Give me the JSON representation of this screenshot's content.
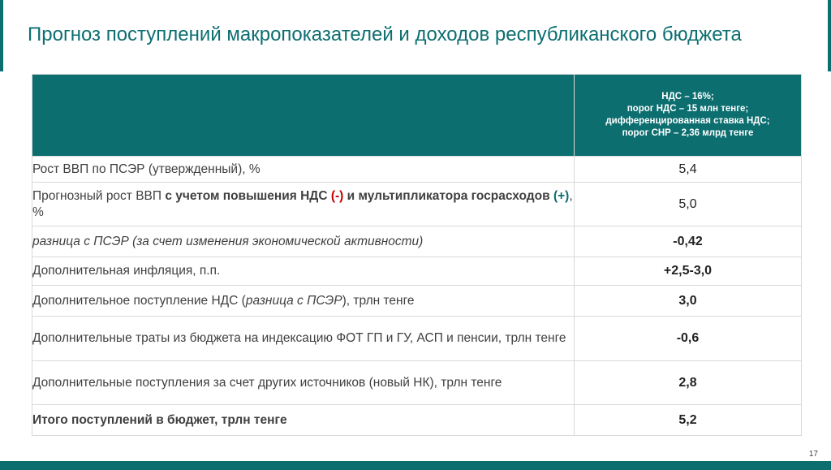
{
  "title": "Прогноз поступлений макропоказателей и доходов республиканского бюджета",
  "header": {
    "lines": [
      "НДС – 16%;",
      "порог НДС – 15 млн тенге;",
      "дифференцированная ставка НДС;",
      "порог СНР – 2,36 млрд тенге"
    ]
  },
  "rows": [
    {
      "label": "Рост ВВП по ПСЭР (утвержденный), %",
      "value": "5,4"
    },
    {
      "label_parts": [
        "Прогнозный рост ВВП ",
        "с учетом повышения НДС ",
        "(-)",
        " и мультипликатора госрасходов ",
        "(+)",
        ", %"
      ],
      "value": "5,0"
    },
    {
      "label": "разница с ПСЭР (за счет изменения экономической активности)",
      "value": "-0,42"
    },
    {
      "label": "Дополнительная инфляция, п.п.",
      "value": "+2,5-3,0"
    },
    {
      "label_parts": [
        "Дополнительное поступление НДС (",
        "разница с ПСЭР",
        "), трлн тенге"
      ],
      "value": "3,0"
    },
    {
      "label": "Дополнительные траты из бюджета на индексацию ФОТ ГП и ГУ, АСП и пенсии, трлн тенге",
      "value": "-0,6"
    },
    {
      "label": "Дополнительные поступления за счет других источников (новый НК), трлн тенге",
      "value": "2,8"
    },
    {
      "label": "Итого поступлений в бюджет, трлн тенге",
      "value": "5,2"
    }
  ],
  "page_number": "17",
  "colors": {
    "brand": "#0d6e70",
    "negative": "#c00000",
    "positive": "#0d6e70",
    "text": "#404040"
  }
}
